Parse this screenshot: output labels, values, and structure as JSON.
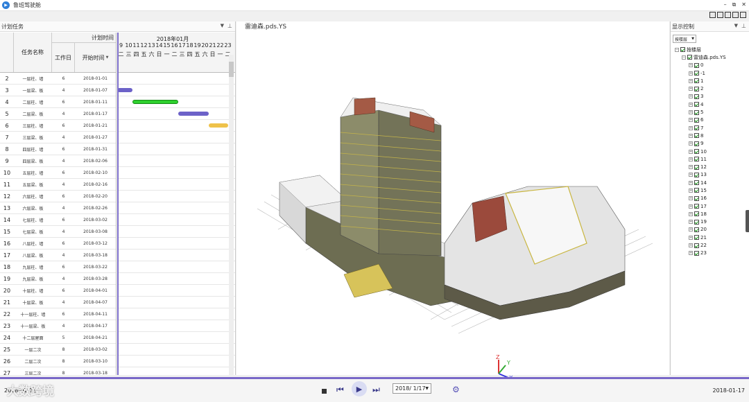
{
  "window": {
    "title": "鲁班驾驶舱",
    "minimize": "–",
    "restore": "⧉",
    "close": "✕"
  },
  "left_panel": {
    "title": "计划任务",
    "header": {
      "name": "任务名称",
      "plan_time": "计划时间",
      "workdays": "工作日",
      "start_time": "开始时间"
    },
    "gantt": {
      "month": "2018年01月",
      "days": [
        "9",
        "10",
        "11",
        "12",
        "13",
        "14",
        "15",
        "16",
        "17",
        "18",
        "19",
        "20",
        "21",
        "22",
        "23"
      ],
      "weekdays": [
        "二",
        "三",
        "四",
        "五",
        "六",
        "日",
        "一",
        "二",
        "三",
        "四",
        "五",
        "六",
        "日",
        "一",
        "二"
      ]
    },
    "rows": [
      {
        "num": "2",
        "name": "一层柱、墙",
        "days": "6",
        "start": "2018-01-01"
      },
      {
        "num": "3",
        "name": "一层梁、板",
        "days": "4",
        "start": "2018-01-07"
      },
      {
        "num": "4",
        "name": "二层柱、墙",
        "days": "6",
        "start": "2018-01-11"
      },
      {
        "num": "5",
        "name": "二层梁、板",
        "days": "4",
        "start": "2018-01-17"
      },
      {
        "num": "6",
        "name": "三层柱、墙",
        "days": "6",
        "start": "2018-01-21"
      },
      {
        "num": "7",
        "name": "三层梁、板",
        "days": "4",
        "start": "2018-01-27"
      },
      {
        "num": "8",
        "name": "四层柱、墙",
        "days": "6",
        "start": "2018-01-31"
      },
      {
        "num": "9",
        "name": "四层梁、板",
        "days": "4",
        "start": "2018-02-06"
      },
      {
        "num": "10",
        "name": "五层柱、墙",
        "days": "6",
        "start": "2018-02-10"
      },
      {
        "num": "11",
        "name": "五层梁、板",
        "days": "4",
        "start": "2018-02-16"
      },
      {
        "num": "12",
        "name": "六层柱、墙",
        "days": "6",
        "start": "2018-02-20"
      },
      {
        "num": "13",
        "name": "六层梁、板",
        "days": "4",
        "start": "2018-02-26"
      },
      {
        "num": "14",
        "name": "七层柱、墙",
        "days": "6",
        "start": "2018-03-02"
      },
      {
        "num": "15",
        "name": "七层梁、板",
        "days": "4",
        "start": "2018-03-08"
      },
      {
        "num": "16",
        "name": "八层柱、墙",
        "days": "6",
        "start": "2018-03-12"
      },
      {
        "num": "17",
        "name": "八层梁、板",
        "days": "4",
        "start": "2018-03-18"
      },
      {
        "num": "18",
        "name": "九层柱、墙",
        "days": "6",
        "start": "2018-03-22"
      },
      {
        "num": "19",
        "name": "九层梁、板",
        "days": "4",
        "start": "2018-03-28"
      },
      {
        "num": "20",
        "name": "十层柱、墙",
        "days": "6",
        "start": "2018-04-01"
      },
      {
        "num": "21",
        "name": "十层梁、板",
        "days": "4",
        "start": "2018-04-07"
      },
      {
        "num": "22",
        "name": "十一层柱、墙",
        "days": "6",
        "start": "2018-04-11"
      },
      {
        "num": "23",
        "name": "十一层梁、板",
        "days": "4",
        "start": "2018-04-17"
      },
      {
        "num": "24",
        "name": "十二层屋面",
        "days": "5",
        "start": "2018-04-21"
      },
      {
        "num": "25",
        "name": "一层二次",
        "days": "8",
        "start": "2018-03-02"
      },
      {
        "num": "26",
        "name": "二层二次",
        "days": "8",
        "start": "2018-03-10"
      },
      {
        "num": "27",
        "name": "三层二次",
        "days": "8",
        "start": "2018-03-18"
      }
    ]
  },
  "view": {
    "title": "雷迪森.pds.YS",
    "axis_x": "X",
    "axis_y": "Y",
    "axis_z": "Z"
  },
  "right_panel": {
    "title": "显示控制",
    "layer_mode": "按楼层",
    "root": "按楼层",
    "file": "雷迪森.pds.YS",
    "floors": [
      "0",
      "-1",
      "1",
      "2",
      "3",
      "4",
      "5",
      "6",
      "7",
      "8",
      "9",
      "10",
      "11",
      "12",
      "13",
      "14",
      "15",
      "16",
      "17",
      "18",
      "19",
      "20",
      "21",
      "22",
      "23"
    ]
  },
  "bottom": {
    "start_date": "2018-01-11",
    "end_date": "2018-01-17",
    "current_date": "2018/ 1/17",
    "watermark": "大数跨境"
  },
  "colors": {
    "accent": "#7867c8",
    "bar_purple": "#6c62c8",
    "bar_green": "#2ed02e",
    "bar_yellow": "#efc24a"
  }
}
